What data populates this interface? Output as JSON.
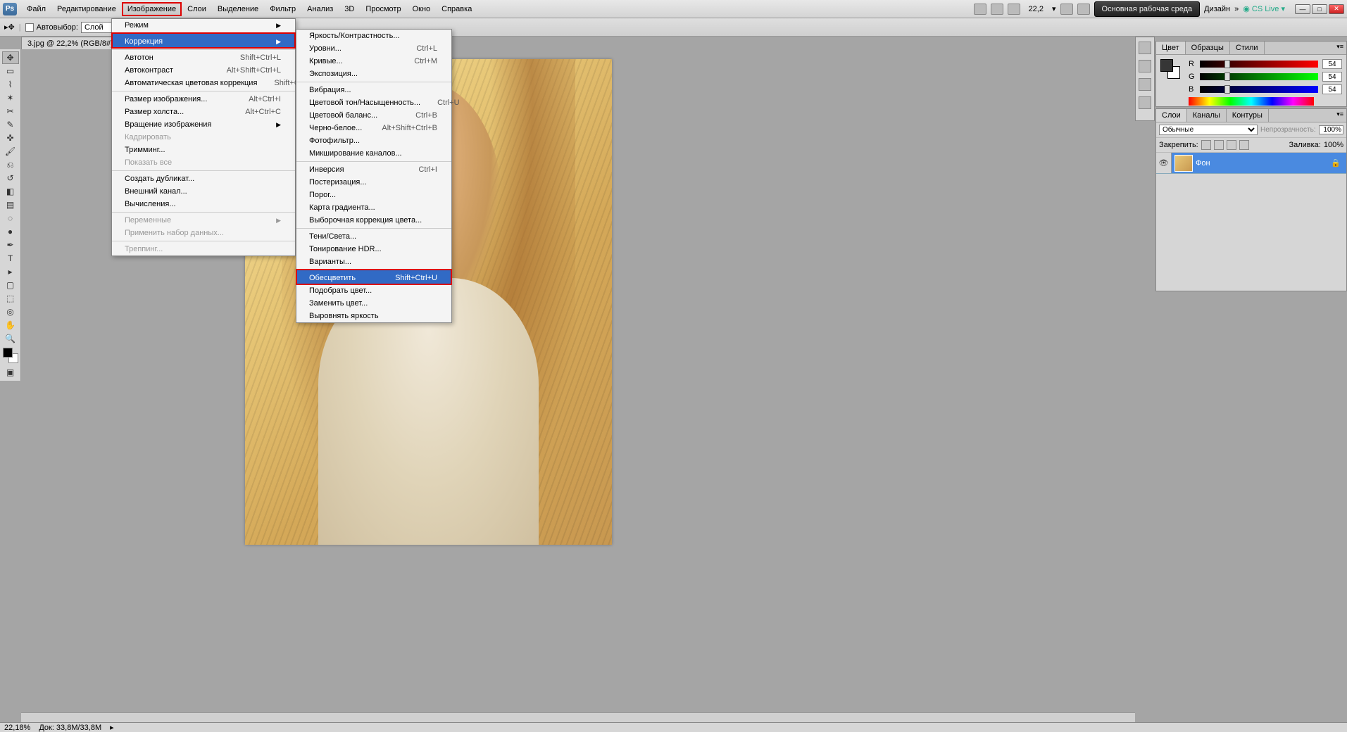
{
  "menubar": {
    "items": [
      "Файл",
      "Редактирование",
      "Изображение",
      "Слои",
      "Выделение",
      "Фильтр",
      "Анализ",
      "3D",
      "Просмотр",
      "Окно",
      "Справка"
    ],
    "highlighted_index": 2,
    "zoom": "22,2",
    "workspace_main": "Основная рабочая среда",
    "workspace_design": "Дизайн",
    "cslive": "CS Live"
  },
  "optionsbar": {
    "tool_icon": "move-tool-icon",
    "auto_select_label": "Автовыбор:",
    "auto_select_value": "Слой"
  },
  "doctab": {
    "label": "3.jpg @ 22,2% (RGB/8#)",
    "close": "×"
  },
  "menu_image": {
    "groups": [
      [
        {
          "label": "Режим",
          "arrow": true
        }
      ],
      [
        {
          "label": "Коррекция",
          "arrow": true,
          "highlight": "blue-red"
        }
      ],
      [
        {
          "label": "Автотон",
          "sc": "Shift+Ctrl+L"
        },
        {
          "label": "Автоконтраст",
          "sc": "Alt+Shift+Ctrl+L"
        },
        {
          "label": "Автоматическая цветовая коррекция",
          "sc": "Shift+Ctrl+B"
        }
      ],
      [
        {
          "label": "Размер изображения...",
          "sc": "Alt+Ctrl+I"
        },
        {
          "label": "Размер холста...",
          "sc": "Alt+Ctrl+C"
        },
        {
          "label": "Вращение изображения",
          "arrow": true
        },
        {
          "label": "Кадрировать",
          "disabled": true
        },
        {
          "label": "Тримминг..."
        },
        {
          "label": "Показать все",
          "disabled": true
        }
      ],
      [
        {
          "label": "Создать дубликат..."
        },
        {
          "label": "Внешний канал..."
        },
        {
          "label": "Вычисления..."
        }
      ],
      [
        {
          "label": "Переменные",
          "arrow": true,
          "disabled": true
        },
        {
          "label": "Применить набор данных...",
          "disabled": true
        }
      ],
      [
        {
          "label": "Треппинг...",
          "disabled": true
        }
      ]
    ]
  },
  "menu_correction": {
    "groups": [
      [
        {
          "label": "Яркость/Контрастность..."
        },
        {
          "label": "Уровни...",
          "sc": "Ctrl+L"
        },
        {
          "label": "Кривые...",
          "sc": "Ctrl+M"
        },
        {
          "label": "Экспозиция..."
        }
      ],
      [
        {
          "label": "Вибрация..."
        },
        {
          "label": "Цветовой тон/Насыщенность...",
          "sc": "Ctrl+U"
        },
        {
          "label": "Цветовой баланс...",
          "sc": "Ctrl+B"
        },
        {
          "label": "Черно-белое...",
          "sc": "Alt+Shift+Ctrl+B"
        },
        {
          "label": "Фотофильтр..."
        },
        {
          "label": "Микширование каналов..."
        }
      ],
      [
        {
          "label": "Инверсия",
          "sc": "Ctrl+I"
        },
        {
          "label": "Постеризация..."
        },
        {
          "label": "Порог..."
        },
        {
          "label": "Карта градиента..."
        },
        {
          "label": "Выборочная коррекция цвета..."
        }
      ],
      [
        {
          "label": "Тени/Света..."
        },
        {
          "label": "Тонирование HDR..."
        },
        {
          "label": "Варианты..."
        }
      ],
      [
        {
          "label": "Обесцветить",
          "sc": "Shift+Ctrl+U",
          "highlight": "blue-red"
        },
        {
          "label": "Подобрать цвет..."
        },
        {
          "label": "Заменить цвет..."
        },
        {
          "label": "Выровнять яркость"
        }
      ]
    ]
  },
  "panels": {
    "color": {
      "tabs": [
        "Цвет",
        "Образцы",
        "Стили"
      ],
      "r_label": "R",
      "g_label": "G",
      "b_label": "B",
      "r": "54",
      "g": "54",
      "b": "54"
    },
    "layers": {
      "tabs": [
        "Слои",
        "Каналы",
        "Контуры"
      ],
      "blend": "Обычные",
      "opacity_label": "Непрозрачность:",
      "opacity": "100%",
      "lock_label": "Закрепить:",
      "fill_label": "Заливка:",
      "fill": "100%",
      "layer_name": "Фон"
    }
  },
  "statusbar": {
    "zoom": "22,18%",
    "doc": "Док: 33,8M/33,8M"
  }
}
